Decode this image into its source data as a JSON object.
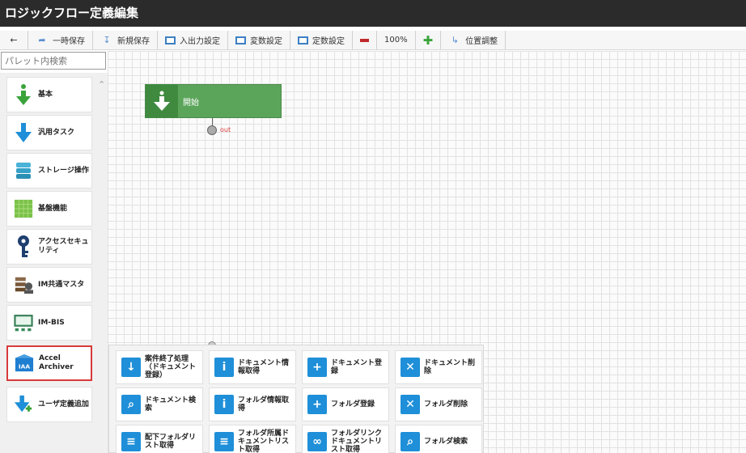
{
  "window": {
    "title": "ロジックフロー定義編集"
  },
  "toolbar": {
    "back_icon": "arrow-left-icon",
    "temp_save": "一時保存",
    "new_save": "新規保存",
    "io_settings": "入出力設定",
    "var_settings": "変数設定",
    "const_settings": "定数設定",
    "zoom": "100%",
    "position_adjust": "位置調整"
  },
  "search": {
    "placeholder": "パレット内検索"
  },
  "palette": {
    "items": [
      {
        "label": "基本"
      },
      {
        "label": "汎用タスク"
      },
      {
        "label": "ストレージ操作"
      },
      {
        "label": "基盤機能"
      },
      {
        "label": "アクセスセキュリティ"
      },
      {
        "label": "IM共通マスタ"
      },
      {
        "label": "IM-BIS"
      },
      {
        "label": "Accel Archiver"
      },
      {
        "label": "ユーザ定義追加"
      }
    ]
  },
  "canvas": {
    "start_node": "開始",
    "out_label": "out"
  },
  "subpalette": {
    "items": [
      {
        "label": "案件終了処理（ドキュメント登録）"
      },
      {
        "label": "ドキュメント情報取得"
      },
      {
        "label": "ドキュメント登録"
      },
      {
        "label": "ドキュメント削除"
      },
      {
        "label": "ドキュメント検索"
      },
      {
        "label": "フォルダ情報取得"
      },
      {
        "label": "フォルダ登録"
      },
      {
        "label": "フォルダ削除"
      },
      {
        "label": "配下フォルダリスト取得"
      },
      {
        "label": "フォルダ所属ドキュメントリスト取得"
      },
      {
        "label": "フォルダリンクドキュメントリスト取得"
      },
      {
        "label": "フォルダ検索"
      }
    ]
  },
  "colors": {
    "accent_green": "#5ba55b",
    "selected_border": "#d83a3a",
    "doc_blue": "#1e8fd8"
  }
}
